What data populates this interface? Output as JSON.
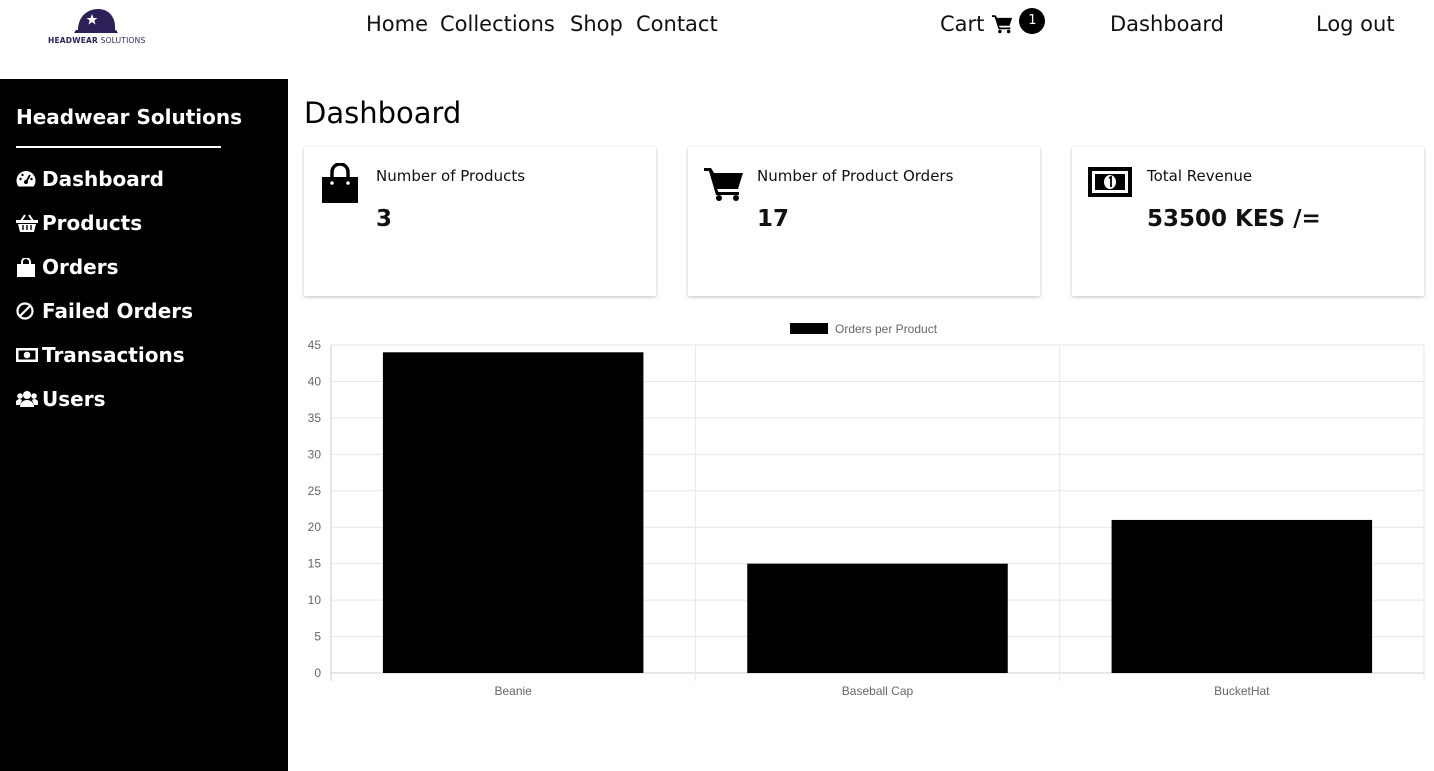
{
  "brand": {
    "logo_text_bold": "HEADWEAR",
    "logo_text_light": "SOLUTIONS"
  },
  "nav": {
    "links": [
      "Home",
      "Collections",
      "Shop",
      "Contact"
    ],
    "cart_label": "Cart",
    "cart_count": "1",
    "dashboard": "Dashboard",
    "logout": "Log out"
  },
  "sidebar": {
    "title": "Headwear Solutions",
    "items": [
      {
        "label": "Dashboard",
        "icon": "tachometer-icon"
      },
      {
        "label": "Products",
        "icon": "basket-icon"
      },
      {
        "label": "Orders",
        "icon": "shopping-bag-icon"
      },
      {
        "label": "Failed Orders",
        "icon": "ban-icon"
      },
      {
        "label": "Transactions",
        "icon": "money-bill-icon"
      },
      {
        "label": "Users",
        "icon": "users-icon"
      }
    ]
  },
  "main": {
    "title": "Dashboard",
    "cards": [
      {
        "label": "Number of Products",
        "value": "3",
        "icon": "shopping-bag-icon"
      },
      {
        "label": "Number of Product Orders",
        "value": "17",
        "icon": "cart-icon"
      },
      {
        "label": "Total Revenue",
        "value": "53500 KES /=",
        "icon": "money-bill-icon"
      }
    ]
  },
  "colors": {
    "sidebar_bg": "#000000",
    "bar_fill": "#000000",
    "logo_accent": "#2d1f57"
  },
  "chart_data": {
    "type": "bar",
    "categories": [
      "Beanie",
      "Baseball Cap",
      "BucketHat"
    ],
    "series": [
      {
        "name": "Orders per Product",
        "values": [
          44,
          15,
          21
        ]
      }
    ],
    "ylim": [
      0,
      45
    ],
    "yticks": [
      0,
      5,
      10,
      15,
      20,
      25,
      30,
      35,
      40,
      45
    ],
    "grid": true,
    "legend": "top-center"
  }
}
